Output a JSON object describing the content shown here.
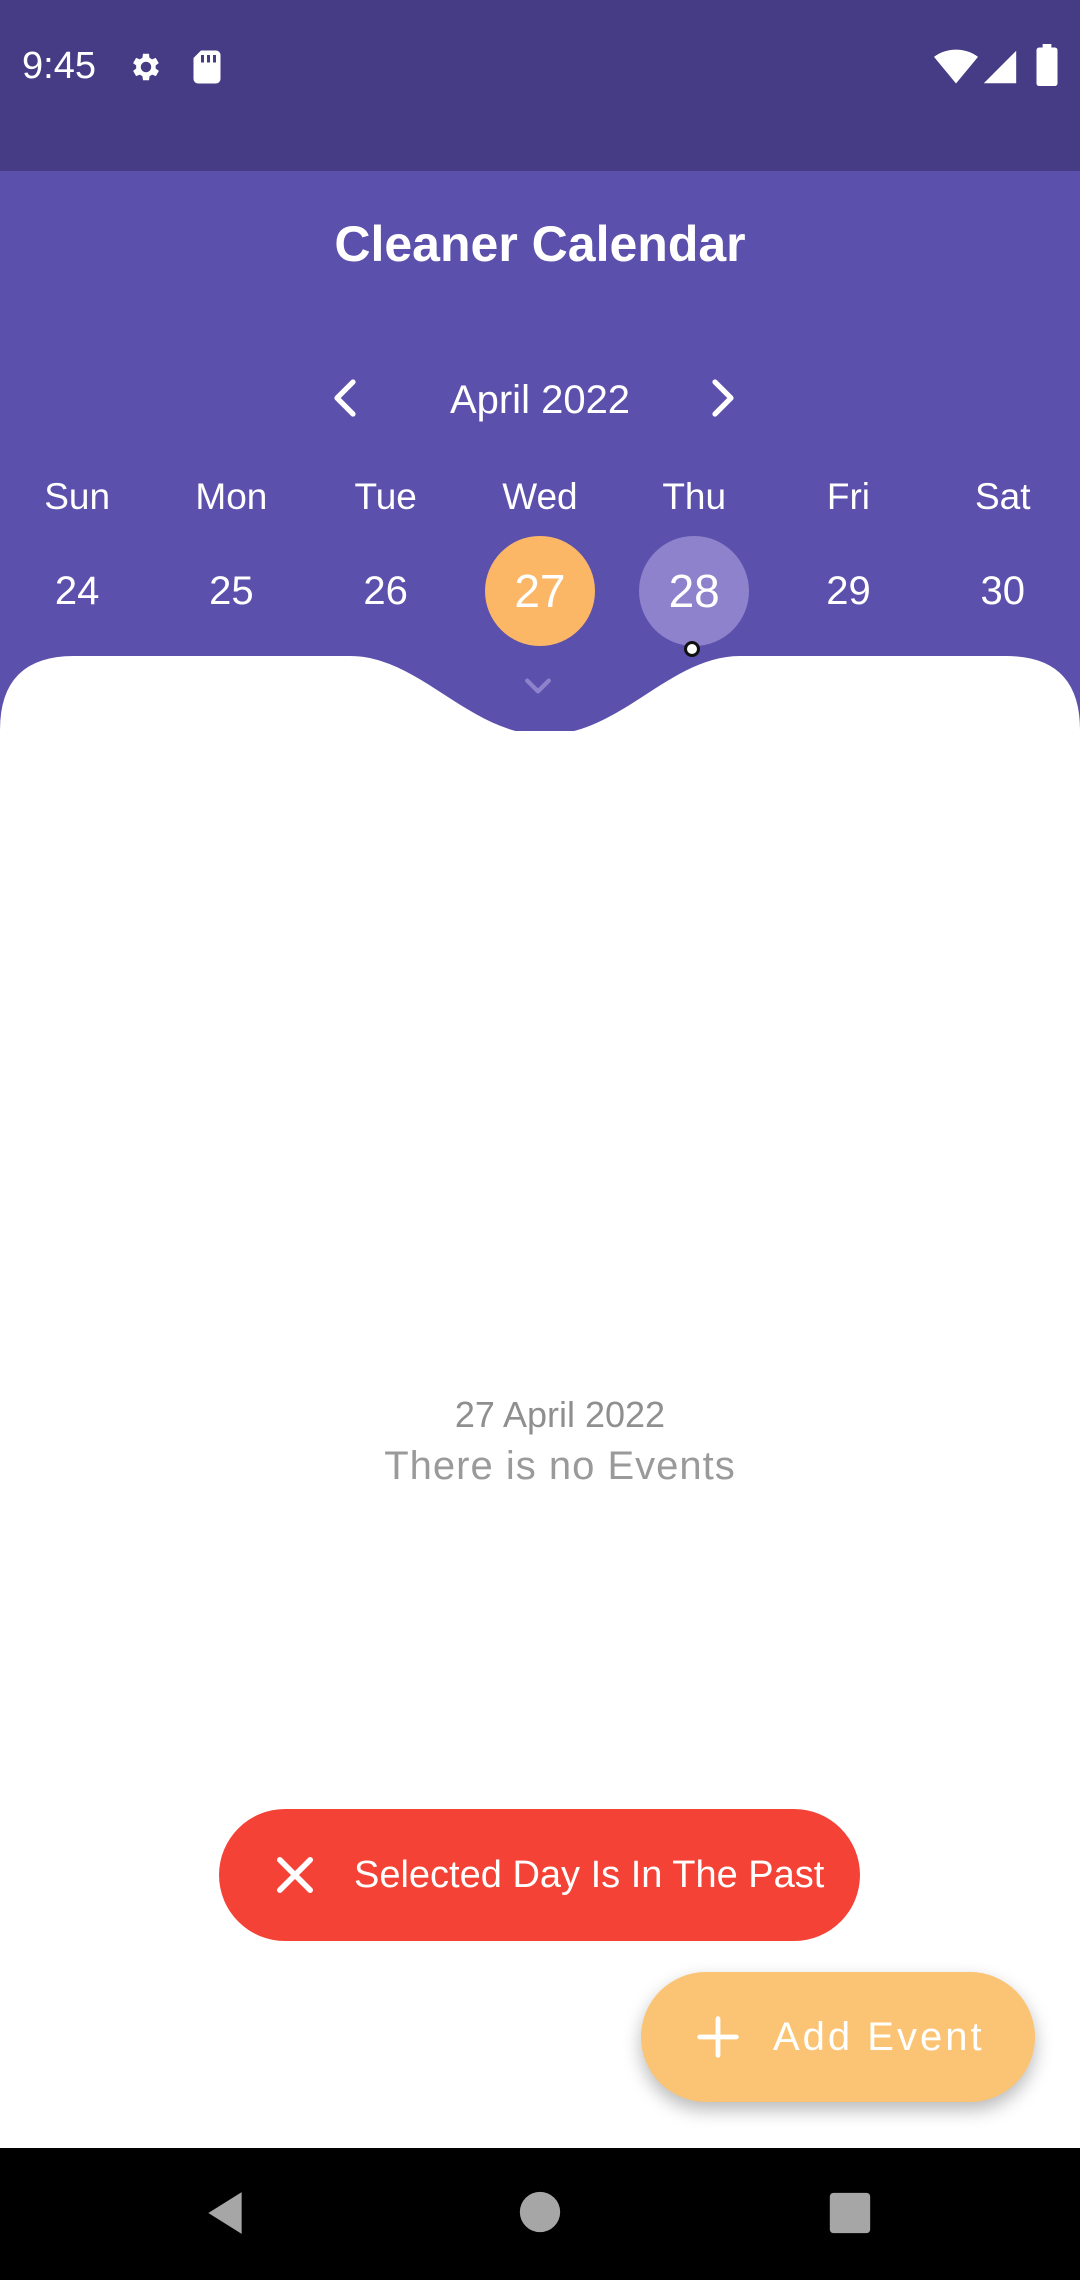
{
  "status_bar": {
    "time": "9:45",
    "left_icons": [
      "settings-gear-icon",
      "sd-card-icon"
    ],
    "right_icons": [
      "wifi-icon",
      "cell-signal-icon",
      "battery-icon"
    ],
    "background": "#463b85"
  },
  "header": {
    "title": "Cleaner Calendar",
    "background": "#5c50ad",
    "month_label": "April 2022",
    "prev_icon": "chevron-left-icon",
    "next_icon": "chevron-right-icon"
  },
  "calendar": {
    "weekdays": [
      "Sun",
      "Mon",
      "Tue",
      "Wed",
      "Thu",
      "Fri",
      "Sat"
    ],
    "dates": [
      "24",
      "25",
      "26",
      "27",
      "28",
      "29",
      "30"
    ],
    "selected_date": "27",
    "today_date": "28",
    "event_marker_date": "28",
    "selected_color": "#fbb766",
    "today_color": "#8d82cb",
    "expand_icon": "chevron-down-icon"
  },
  "events": {
    "date_label": "27 April 2022",
    "empty_message": "There is no Events"
  },
  "toast": {
    "message": "Selected Day Is In The Past",
    "icon": "close-icon",
    "color": "#f44336"
  },
  "fab": {
    "label": "Add Event",
    "icon": "plus-icon",
    "color": "#fbc475"
  },
  "nav_bar": {
    "buttons": [
      "back-icon",
      "home-icon",
      "recents-icon"
    ]
  }
}
